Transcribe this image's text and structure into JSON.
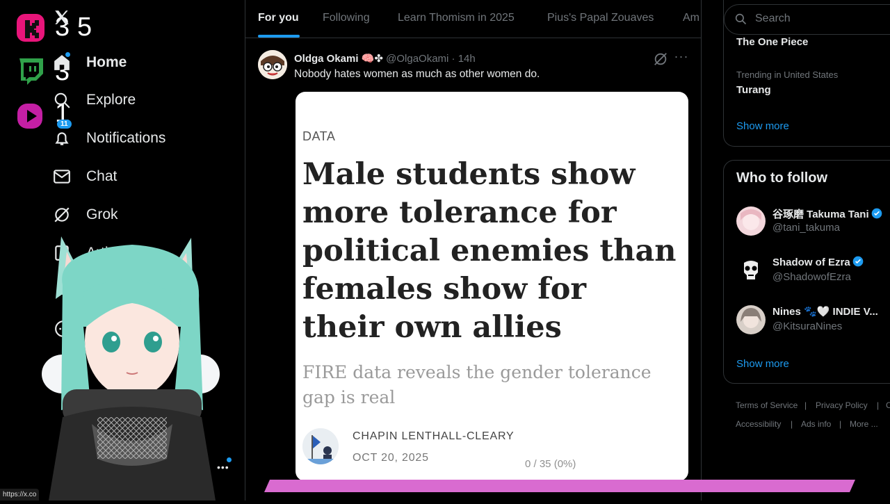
{
  "stream_overlay": {
    "counts": [
      "3",
      "5",
      "3",
      "1"
    ],
    "url_status": "https://x.co"
  },
  "nav": {
    "items": [
      {
        "label": "Home"
      },
      {
        "label": "Explore"
      },
      {
        "label": "Notifications",
        "badge": "11"
      },
      {
        "label": "Chat"
      },
      {
        "label": "Grok"
      },
      {
        "label": "Articles"
      }
    ]
  },
  "tabs": [
    {
      "label": "For you"
    },
    {
      "label": "Following"
    },
    {
      "label": "Learn Thomism in 2025"
    },
    {
      "label": "Pius's Papal Zouaves"
    },
    {
      "label": "Am"
    }
  ],
  "post": {
    "author_name": "Oldga Okami",
    "author_handle": "@OlgaOkami",
    "time": "14h",
    "text": "Nobody hates women as much as other women do.",
    "card": {
      "tag": "DATA",
      "title": "Male students show more tolerance for political enemies than females show for their own allies",
      "subtitle": "FIRE data reveals the gender tolerance gap is real",
      "author": "CHAPIN LENTHALL-CLEARY",
      "date": "OCT 20, 2025"
    }
  },
  "progress": {
    "text": "0 / 35 (0%)",
    "fraction": 0,
    "color": "#d96bd0"
  },
  "search": {
    "placeholder": "Search"
  },
  "trends": {
    "items": [
      {
        "name": "The One Piece"
      },
      {
        "context": "Trending in United States",
        "name": "Turang"
      }
    ],
    "show_more": "Show more"
  },
  "who_to_follow": {
    "title": "Who to follow",
    "users": [
      {
        "name": "谷琢磨 Takuma Tani",
        "handle": "@tani_takuma",
        "verified": true
      },
      {
        "name": "Shadow of Ezra",
        "handle": "@ShadowofEzra",
        "verified": true
      },
      {
        "name": "Nines 🐾🤍 INDIE V...",
        "handle": "@KitsuraNines",
        "verified": false
      }
    ],
    "show_more": "Show more"
  },
  "footer": {
    "links": [
      "Terms of Service",
      "Privacy Policy",
      "C",
      "Accessibility",
      "Ads info",
      "More ..."
    ]
  },
  "colors": {
    "accent": "#1d9bf0",
    "background": "#000000",
    "border": "#2f3336"
  }
}
